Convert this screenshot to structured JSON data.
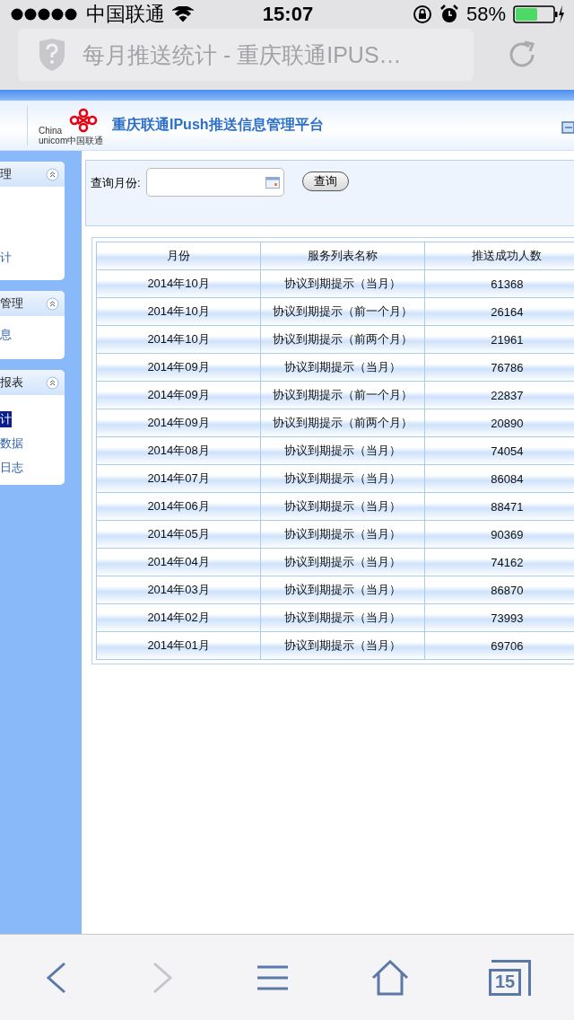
{
  "status_bar": {
    "carrier": "中国联通",
    "time": "15:07",
    "battery": "58%"
  },
  "address_bar": {
    "title": "每月推送统计 - 重庆联通IPUS…"
  },
  "header": {
    "logo_text_1": "China",
    "logo_text_2": "unicom中国联通",
    "title": "重庆联通IPush推送信息管理平台"
  },
  "sidebar": [
    {
      "title": "理",
      "items": [
        {
          "label": "计",
          "selected": false
        }
      ]
    },
    {
      "title": "管理",
      "items": [
        {
          "label": "息",
          "selected": false
        }
      ]
    },
    {
      "title": "报表",
      "items": [
        {
          "label": "计",
          "selected": true
        },
        {
          "label": "数据",
          "selected": false
        },
        {
          "label": "日志",
          "selected": false
        }
      ]
    }
  ],
  "search": {
    "label": "查询月份:",
    "button": "查询"
  },
  "table": {
    "columns": [
      "月份",
      "服务列表名称",
      "推送成功人数"
    ],
    "rows": [
      [
        "2014年10月",
        "协议到期提示（当月）",
        "61368"
      ],
      [
        "2014年10月",
        "协议到期提示（前一个月）",
        "26164"
      ],
      [
        "2014年10月",
        "协议到期提示（前两个月）",
        "21961"
      ],
      [
        "2014年09月",
        "协议到期提示（当月）",
        "76786"
      ],
      [
        "2014年09月",
        "协议到期提示（前一个月）",
        "22837"
      ],
      [
        "2014年09月",
        "协议到期提示（前两个月）",
        "20890"
      ],
      [
        "2014年08月",
        "协议到期提示（当月）",
        "74054"
      ],
      [
        "2014年07月",
        "协议到期提示（当月）",
        "86084"
      ],
      [
        "2014年06月",
        "协议到期提示（当月）",
        "88471"
      ],
      [
        "2014年05月",
        "协议到期提示（当月）",
        "90369"
      ],
      [
        "2014年04月",
        "协议到期提示（当月）",
        "74162"
      ],
      [
        "2014年03月",
        "协议到期提示（当月）",
        "86870"
      ],
      [
        "2014年02月",
        "协议到期提示（当月）",
        "73993"
      ],
      [
        "2014年01月",
        "协议到期提示（当月）",
        "69706"
      ]
    ]
  },
  "toolbar": {
    "tabs_count": "15"
  }
}
